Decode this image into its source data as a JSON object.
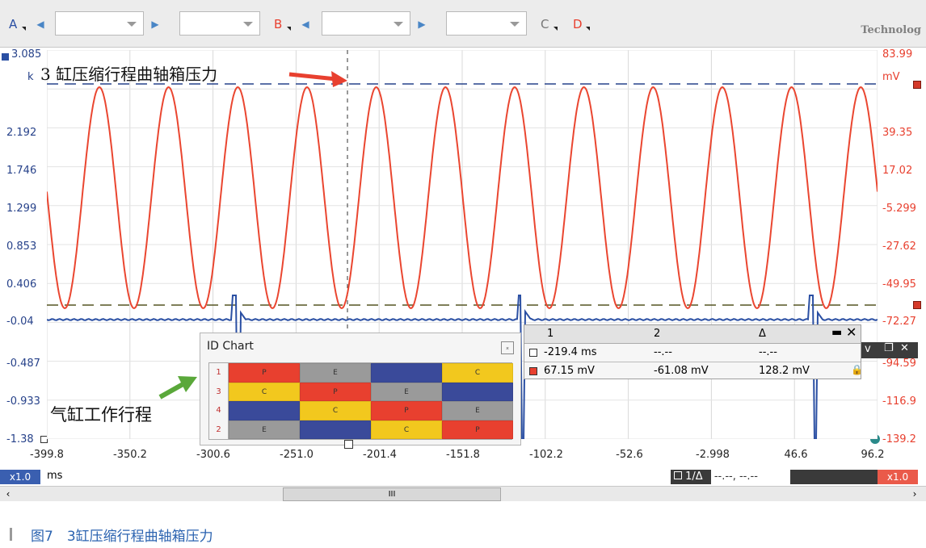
{
  "toolbar": {
    "channels": [
      {
        "id": "A",
        "color": "#2a4fa3"
      },
      {
        "id": "B",
        "color": "#e8402f"
      },
      {
        "id": "C",
        "color": "#8a8a8a"
      },
      {
        "id": "D",
        "color": "#e8402f"
      }
    ],
    "brand": "Technolog"
  },
  "left_axis": {
    "unit": "k",
    "ticks": [
      "3.085",
      "2.192",
      "1.746",
      "1.299",
      "0.853",
      "0.406",
      "-0.04",
      "-0.487",
      "-0.933",
      "-1.38"
    ]
  },
  "right_axis": {
    "unit": "mV",
    "ticks": [
      "83.99",
      "39.35",
      "17.02",
      "-5.299",
      "-27.62",
      "-49.95",
      "-72.27",
      "-94.59",
      "-116.9",
      "-139.2"
    ]
  },
  "x_axis": {
    "unit": "ms",
    "ticks": [
      "-399.8",
      "-350.2",
      "-300.6",
      "-251.0",
      "-201.4",
      "-151.8",
      "-102.2",
      "-52.6",
      "-2.998",
      "46.6",
      "96.2"
    ]
  },
  "annotations": {
    "top_label": "3 缸压缩行程曲轴箱压力",
    "id_label": "气缸工作行程"
  },
  "id_chart": {
    "title": "ID Chart",
    "rows": [
      {
        "num": "1",
        "cells": [
          {
            "label": "P",
            "color": "#e8402f"
          },
          {
            "label": "E",
            "color": "#9a9a9a"
          },
          {
            "label": "",
            "color": "#3a4a9a"
          },
          {
            "label": "C",
            "color": "#f2c81e"
          }
        ]
      },
      {
        "num": "3",
        "cells": [
          {
            "label": "C",
            "color": "#f2c81e"
          },
          {
            "label": "P",
            "color": "#e8402f"
          },
          {
            "label": "E",
            "color": "#9a9a9a"
          },
          {
            "label": "",
            "color": "#3a4a9a"
          }
        ]
      },
      {
        "num": "4",
        "cells": [
          {
            "label": "",
            "color": "#3a4a9a"
          },
          {
            "label": "C",
            "color": "#f2c81e"
          },
          {
            "label": "P",
            "color": "#e8402f"
          },
          {
            "label": "E",
            "color": "#9a9a9a"
          }
        ]
      },
      {
        "num": "2",
        "cells": [
          {
            "label": "E",
            "color": "#9a9a9a"
          },
          {
            "label": "",
            "color": "#3a4a9a"
          },
          {
            "label": "C",
            "color": "#f2c81e"
          },
          {
            "label": "P",
            "color": "#e8402f"
          }
        ]
      }
    ]
  },
  "ruler_table": {
    "headers": [
      "1",
      "2",
      "Δ"
    ],
    "rows": [
      {
        "cells": [
          "-219.4 ms",
          "--.--",
          "--.--"
        ]
      },
      {
        "cells": [
          "67.15 mV",
          "-61.08 mV",
          "128.2 mV"
        ]
      }
    ]
  },
  "bottom_bar": {
    "left_zoom": "x1.0",
    "unit": "ms",
    "ruler_label": "1/Δ",
    "ruler_value": "--.--, --.--",
    "right_zoom": "x1.0"
  },
  "scroll_mark": "III",
  "caption": "图7　3缸压缩行程曲轴箱压力",
  "chart_data": {
    "type": "line",
    "x_range": [
      -399.8,
      96.2
    ],
    "series": [
      {
        "channel": "B",
        "color": "#e8402f",
        "axis": "right",
        "cycles": 12,
        "min_mv": -60,
        "max_mv": 67.15
      },
      {
        "channel": "A",
        "color": "#2a4fa3",
        "axis": "left",
        "baseline": -0.04,
        "spikes_at_ms": [
          -300.6,
          -151.8,
          62
        ]
      }
    ],
    "reference_lines": [
      {
        "axis": "right",
        "value": 67.15
      },
      {
        "axis": "right",
        "value": -61.08
      }
    ],
    "cursor_x": -219.4,
    "grid": true
  }
}
